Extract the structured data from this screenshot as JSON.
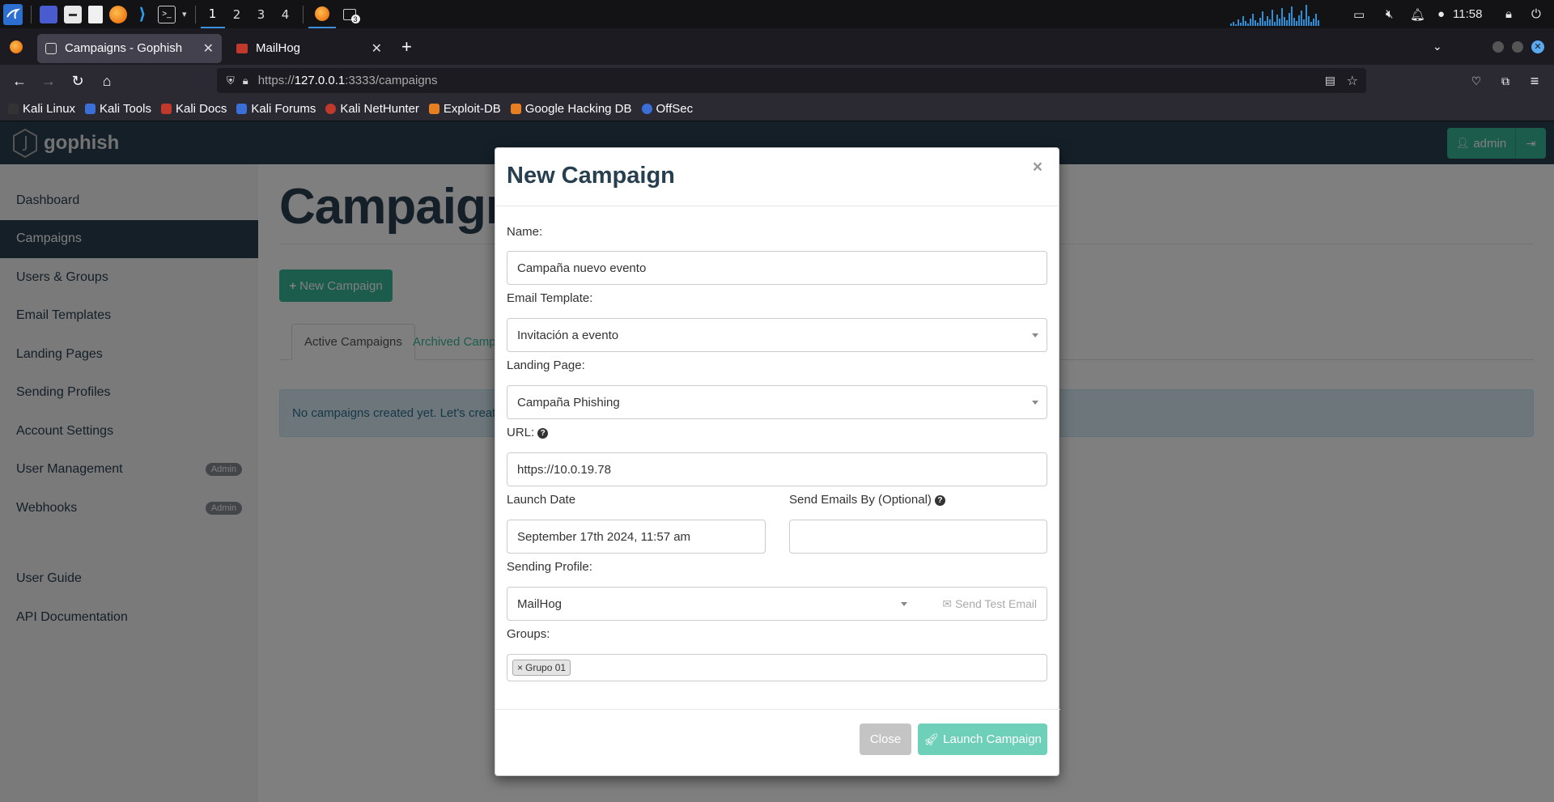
{
  "os": {
    "workspaces": [
      "1",
      "2",
      "3",
      "4"
    ],
    "clock": "11:58",
    "terminal_badge": "3"
  },
  "browser": {
    "tabs": [
      {
        "title": "Campaigns - Gophish",
        "active": true
      },
      {
        "title": "MailHog",
        "active": false
      }
    ],
    "url_prefix": "https://",
    "url_host": "127.0.0.1",
    "url_path": ":3333/campaigns",
    "bookmarks": [
      "Kali Linux",
      "Kali Tools",
      "Kali Docs",
      "Kali Forums",
      "Kali NetHunter",
      "Exploit-DB",
      "Google Hacking DB",
      "OffSec"
    ]
  },
  "gophish": {
    "brand": "gophish",
    "user": "admin",
    "sidebar": [
      {
        "label": "Dashboard"
      },
      {
        "label": "Campaigns",
        "active": true
      },
      {
        "label": "Users & Groups"
      },
      {
        "label": "Email Templates"
      },
      {
        "label": "Landing Pages"
      },
      {
        "label": "Sending Profiles"
      },
      {
        "label": "Account Settings"
      },
      {
        "label": "User Management",
        "badge": "Admin"
      },
      {
        "label": "Webhooks",
        "badge": "Admin"
      }
    ],
    "sidebar_bottom": [
      "User Guide",
      "API Documentation"
    ],
    "page_title": "Campaigns",
    "new_campaign_button": "New Campaign",
    "tabs": [
      "Active Campaigns",
      "Archived Campaigns"
    ],
    "alert": "No campaigns created yet. Let's create one!"
  },
  "modal": {
    "title": "New Campaign",
    "close_x": "×",
    "name_label": "Name:",
    "name_value": "Campaña nuevo evento",
    "template_label": "Email Template:",
    "template_value": "Invitación a evento",
    "landing_label": "Landing Page:",
    "landing_value": "Campaña Phishing",
    "url_label": "URL:",
    "url_value": "https://10.0.19.78",
    "launch_date_label": "Launch Date",
    "launch_date_value": "September 17th 2024, 11:57 am",
    "send_by_label": "Send Emails By (Optional)",
    "send_by_value": "",
    "profile_label": "Sending Profile:",
    "profile_value": "MailHog",
    "send_test_label": "Send Test Email",
    "groups_label": "Groups:",
    "groups": [
      "Grupo 01"
    ],
    "close_button": "Close",
    "launch_button": "Launch Campaign"
  },
  "colors": {
    "navbar": "#283f50",
    "accent": "#37b89b",
    "alert_bg": "#d9edf7"
  }
}
